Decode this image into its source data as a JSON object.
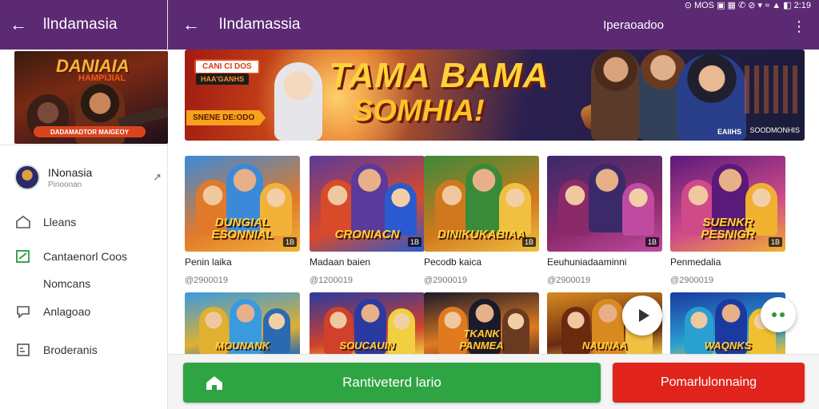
{
  "status_bar": {
    "text": "⊙ MOS ▣ ▦ ✆ ⊘ ▾ ≈ ▲ ◧ 2:19"
  },
  "left_panel": {
    "title": "llndamasia",
    "banner": {
      "title": "DANIAIA",
      "subtitle": "HAMPIJIAL",
      "strip_text": "DADAMADTOR MAIGEOY"
    },
    "profile": {
      "name": "INonasia",
      "sub": "Pinoonan"
    },
    "menu": [
      {
        "label": "Lleans",
        "icon": "home-icon"
      },
      {
        "label": "Cantaenorl Coos",
        "icon": "checkbox-icon"
      },
      {
        "label": "Nomcans",
        "icon": "none"
      },
      {
        "label": "Anlagoao",
        "icon": "chat-icon"
      },
      {
        "label": "Broderanis",
        "icon": "document-icon"
      }
    ]
  },
  "app_bar": {
    "title": "lIndamassia",
    "right_label": "Iperaoadoo"
  },
  "hero_banner": {
    "tag_top": "CANI CI DOS",
    "tag_mid": "HAA'GANHS",
    "line1": "TAMA BAMA",
    "line2": "SOMHIA!",
    "pill": "SNENE DE:ODO",
    "corner_label": "EAIIHS",
    "corner_right": "SOODMONHIS"
  },
  "games": [
    {
      "title": "Penin laika",
      "sub": "@2900019",
      "caption": "DUNGIAL\nESONNIAL",
      "badge": "1B",
      "colors": [
        "#3b8ad9",
        "#e07a2a",
        "#f2b23a"
      ]
    },
    {
      "title": "Madaan baien",
      "sub": "@1200019",
      "caption": "CRONIACN",
      "badge": "1B",
      "colors": [
        "#5a3a9a",
        "#d84a2a",
        "#2a5ad0"
      ]
    },
    {
      "title": "Pecodb kaica",
      "sub": "@2900019",
      "caption": "DINIKUKABIAA",
      "badge": "1B",
      "colors": [
        "#3a8a3a",
        "#d0781e",
        "#f0c040"
      ]
    },
    {
      "title": "Eeuhuniadaaminni",
      "sub": "@2900019",
      "caption": "",
      "badge": "1B",
      "colors": [
        "#3a2a6a",
        "#8a2a6a",
        "#c04aa0"
      ]
    },
    {
      "title": "Penmedalia",
      "sub": "@2900019",
      "caption": "SUENKR\nPESNIGR",
      "badge": "1B",
      "colors": [
        "#5a1a7a",
        "#d04a8a",
        "#f0b030"
      ]
    }
  ],
  "games_row2": [
    {
      "caption": "MOUNANK",
      "colors": [
        "#3a9ae0",
        "#e0b030",
        "#2a6ab0"
      ]
    },
    {
      "caption": "SOUCAUIN",
      "colors": [
        "#2a3aa0",
        "#d0402a",
        "#f0d040"
      ]
    },
    {
      "caption": "TKANK\nPANMEA",
      "colors": [
        "#1a1a2a",
        "#e07a20",
        "#6a3a20"
      ]
    },
    {
      "caption": "NAUNAA",
      "colors": [
        "#d88a20",
        "#6a2a10",
        "#f0c040"
      ]
    },
    {
      "caption": "WAQNKS",
      "colors": [
        "#1a3aa0",
        "#2aa0d0",
        "#f0c030"
      ]
    }
  ],
  "buttons": {
    "primary": "Rantiveterd lario",
    "secondary": "Pomarlulonnaing"
  },
  "theme": {
    "appbar": "#5c2a73",
    "green": "#2fa443",
    "red": "#e0241b"
  }
}
